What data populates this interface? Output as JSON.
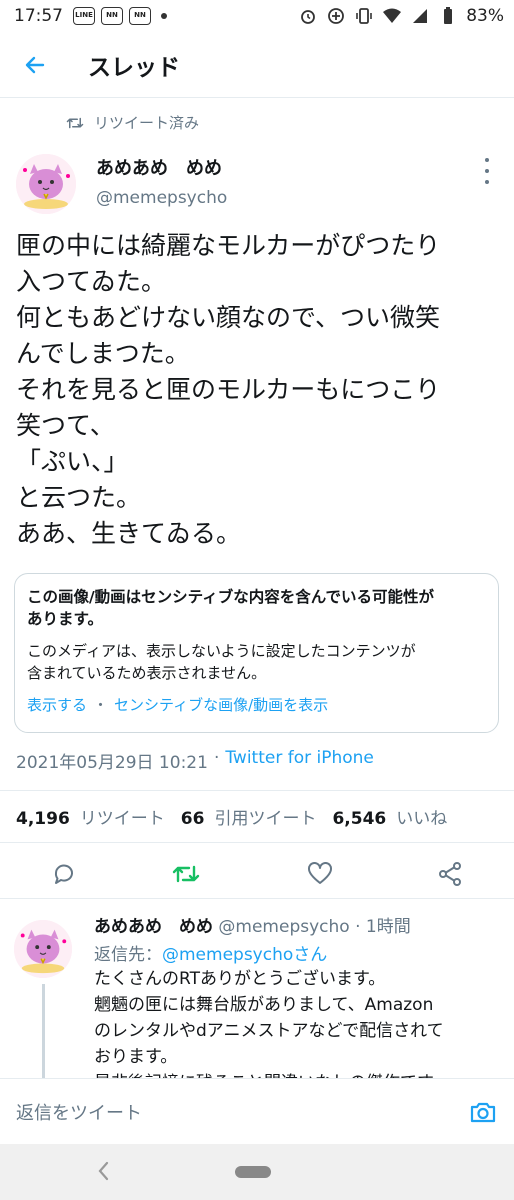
{
  "status_bar": {
    "time": "17:57",
    "app_icons": [
      "LINE",
      "NN",
      "NN"
    ],
    "battery": "83%"
  },
  "header": {
    "title": "スレッド"
  },
  "tweet": {
    "retweet_label": "リツイート済み",
    "author_name": "あめあめ　めめ",
    "author_handle": "@memepsycho",
    "text_lines": [
      "匣の中には綺麗なモルカーがぴつたり",
      "入つてゐた。",
      "何ともあどけない顔なので、つい微笑",
      "んでしまつた。",
      "それを見ると匣のモルカーもにつこり",
      "笑つて、",
      "「ぷい、」",
      "と云つた。",
      "ああ、生きてゐる。"
    ],
    "sensitive": {
      "title_lines": [
        "この画像/動画はセンシティブな内容を含んでいる可能性が",
        "あります。"
      ],
      "body_lines": [
        "このメディアは、表示しないように設定したコンテンツが",
        "含まれているため表示されません。"
      ],
      "show_label": "表示する",
      "separator": "・",
      "settings_label": "センシティブな画像/動画を表示"
    },
    "timestamp": "2021年05月29日 10:21",
    "meta_separator": "·",
    "source": "Twitter for iPhone",
    "stats": {
      "retweets": "4,196",
      "retweets_label": "リツイート",
      "quotes": "66",
      "quotes_label": "引用ツイート",
      "likes": "6,546",
      "likes_label": "いいね"
    }
  },
  "reply": {
    "author_name": "あめあめ　めめ",
    "author_handle": "@memepsycho",
    "time_sep": "·",
    "time": "1時間",
    "reply_to_label": "返信先：",
    "reply_to_user": "@memepsychoさん",
    "text_lines": [
      "たくさんのRTありがとうございます。",
      "魍魎の匣には舞台版がありまして、Amazon",
      "のレンタルやdアニメストアなどで配信されて",
      "おります。",
      "是非後記憶に残ること間違いなしの傑作です"
    ]
  },
  "compose": {
    "placeholder": "返信をツイート"
  },
  "colors": {
    "accent": "#1da1f2",
    "retweet_green": "#17bf63",
    "secondary_text": "#657786",
    "border": "#e6ecf0"
  },
  "icons": {
    "back": "arrow-left-icon",
    "retweet_small": "retweet-icon",
    "more": "more-vertical-icon",
    "reply": "comment-icon",
    "retweet": "retweet-icon",
    "like": "heart-icon",
    "share": "share-icon",
    "camera": "camera-icon"
  }
}
